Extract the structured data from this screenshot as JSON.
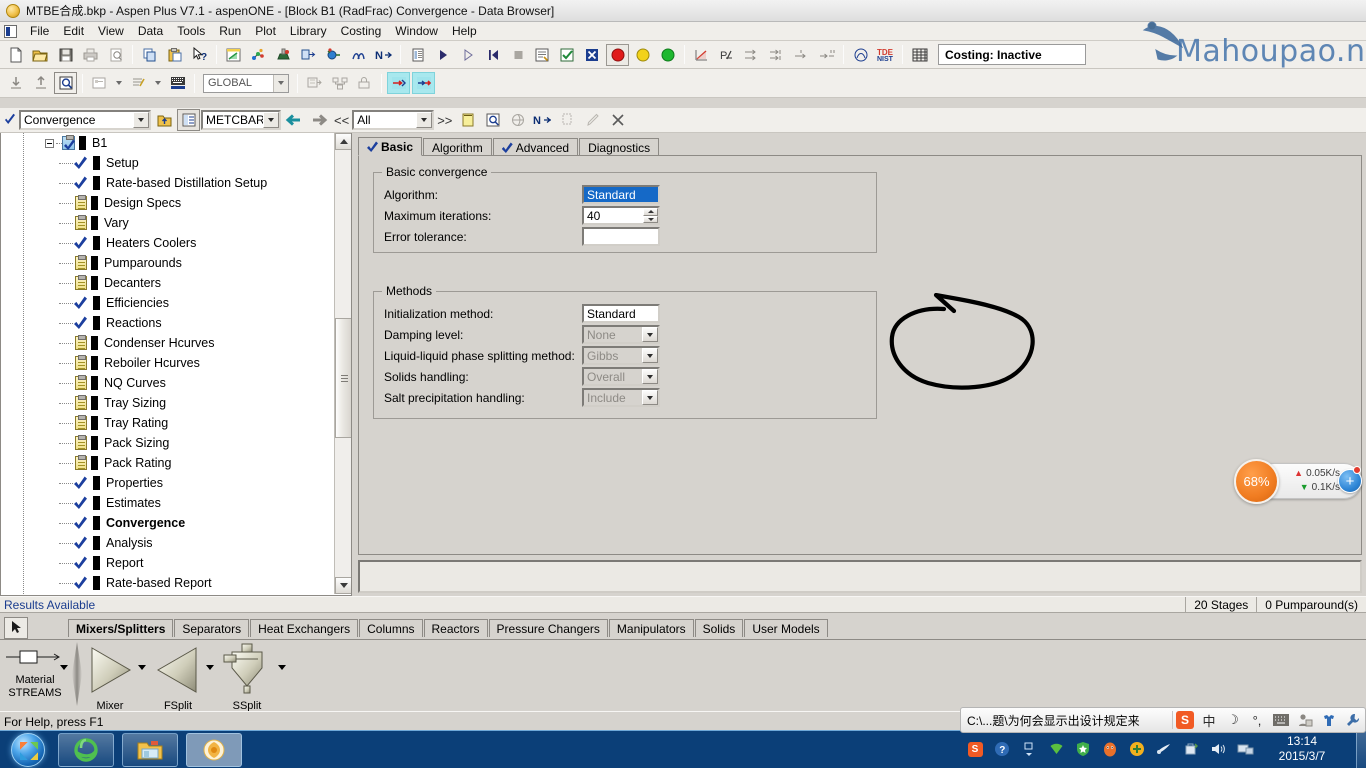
{
  "window": {
    "title": "MTBE合成.bkp - Aspen Plus V7.1 - aspenONE - [Block B1 (RadFrac) Convergence - Data Browser]",
    "app_icon": "aspen-orb-icon"
  },
  "menu": {
    "items": [
      "File",
      "Edit",
      "View",
      "Data",
      "Tools",
      "Run",
      "Plot",
      "Library",
      "Costing",
      "Window",
      "Help"
    ]
  },
  "toolbar": {
    "costing_status": "Costing: Inactive",
    "global_combo": "GLOBAL",
    "watermark": "Mahoupao.net"
  },
  "navbar": {
    "object_combo": "Convergence",
    "units_combo": "METCBAR",
    "filter_combo": "All",
    "prev_label": "<<",
    "next_label": ">>"
  },
  "tree": {
    "root": {
      "label": "B1",
      "icon": "clipboard-check-icon"
    },
    "items": [
      {
        "label": "Setup",
        "icon": "blue-check-icon",
        "complete": true
      },
      {
        "label": "Rate-based Distillation Setup",
        "icon": "blue-check-icon",
        "complete": true
      },
      {
        "label": "Design Specs",
        "icon": "folder-icon",
        "complete": false
      },
      {
        "label": "Vary",
        "icon": "folder-icon",
        "complete": false
      },
      {
        "label": "Heaters Coolers",
        "icon": "blue-check-icon",
        "complete": true
      },
      {
        "label": "Pumparounds",
        "icon": "folder-icon",
        "complete": false
      },
      {
        "label": "Decanters",
        "icon": "folder-icon",
        "complete": false
      },
      {
        "label": "Efficiencies",
        "icon": "blue-check-icon",
        "complete": true
      },
      {
        "label": "Reactions",
        "icon": "blue-check-icon",
        "complete": true
      },
      {
        "label": "Condenser Hcurves",
        "icon": "folder-icon",
        "complete": false
      },
      {
        "label": "Reboiler Hcurves",
        "icon": "folder-icon",
        "complete": false
      },
      {
        "label": "NQ Curves",
        "icon": "folder-icon",
        "complete": false
      },
      {
        "label": "Tray Sizing",
        "icon": "folder-icon",
        "complete": false
      },
      {
        "label": "Tray Rating",
        "icon": "folder-icon",
        "complete": false
      },
      {
        "label": "Pack Sizing",
        "icon": "folder-icon",
        "complete": false
      },
      {
        "label": "Pack Rating",
        "icon": "folder-icon",
        "complete": false
      },
      {
        "label": "Properties",
        "icon": "blue-check-icon",
        "complete": true
      },
      {
        "label": "Estimates",
        "icon": "blue-check-icon",
        "complete": true
      },
      {
        "label": "Convergence",
        "icon": "blue-check-icon",
        "complete": true,
        "selected": true
      },
      {
        "label": "Analysis",
        "icon": "blue-check-icon",
        "complete": true
      },
      {
        "label": "Report",
        "icon": "blue-check-icon",
        "complete": true
      },
      {
        "label": "Rate-based Report",
        "icon": "blue-check-icon",
        "complete": true
      }
    ]
  },
  "form": {
    "tabs": [
      {
        "label": "Basic",
        "check": true,
        "active": true
      },
      {
        "label": "Algorithm",
        "check": false,
        "active": false
      },
      {
        "label": "Advanced",
        "check": true,
        "active": false
      },
      {
        "label": "Diagnostics",
        "check": false,
        "active": false
      }
    ],
    "basic_group": {
      "title": "Basic convergence",
      "algorithm_label": "Algorithm:",
      "algorithm_value": "Standard",
      "max_iterations_label": "Maximum iterations:",
      "max_iterations_value": "40",
      "error_tolerance_label": "Error tolerance:",
      "error_tolerance_value": ""
    },
    "methods_group": {
      "title": "Methods",
      "rows": [
        {
          "label": "Initialization method:",
          "value": "Standard",
          "disabled": false,
          "dropdown": false
        },
        {
          "label": "Damping level:",
          "value": "None",
          "disabled": true,
          "dropdown": true
        },
        {
          "label": "Liquid-liquid phase splitting method:",
          "value": "Gibbs",
          "disabled": true,
          "dropdown": true
        },
        {
          "label": "Solids handling:",
          "value": "Overall",
          "disabled": true,
          "dropdown": true
        },
        {
          "label": "Salt precipitation handling:",
          "value": "Include",
          "disabled": true,
          "dropdown": true
        }
      ]
    }
  },
  "statusbar": {
    "results": "Results Available",
    "stages": "20 Stages",
    "pumparounds": "0 Pumparound(s)"
  },
  "palette": {
    "tabs": [
      "Mixers/Splitters",
      "Separators",
      "Heat Exchangers",
      "Columns",
      "Reactors",
      "Pressure Changers",
      "Manipulators",
      "Solids",
      "User Models"
    ],
    "active_tab": "Mixers/Splitters",
    "streams": {
      "name": "Material",
      "group": "STREAMS"
    },
    "models": [
      {
        "name": "Mixer"
      },
      {
        "name": "FSplit"
      },
      {
        "name": "SSplit"
      }
    ]
  },
  "help": {
    "text": "For Help, press F1"
  },
  "ime": {
    "path": "C:\\...题\\为何会显示出设计规定来",
    "lang": "中",
    "logo": "S"
  },
  "netwidget": {
    "percent": "68%",
    "upload": "0.05K/s",
    "download": "0.1K/s",
    "plus": "+"
  },
  "taskbar": {
    "time": "13:14",
    "date": "2015/3/7",
    "buttons": [
      "internet-explorer-icon",
      "file-explorer-icon",
      "aspen-plus-icon"
    ]
  },
  "colors": {
    "selection_blue": "#1569c7",
    "results_text": "#1b3d8f",
    "face": "#d6d3ce",
    "accent_orange": "#f07c21"
  }
}
